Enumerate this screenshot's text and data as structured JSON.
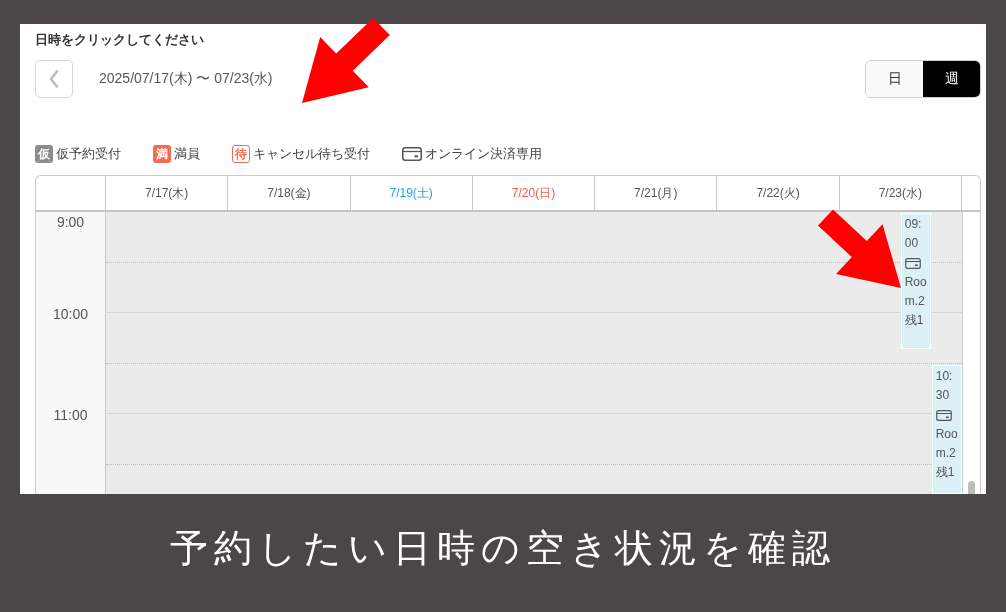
{
  "instruction": "日時をクリックしてください",
  "date_range": "2025/07/17(木) 〜 07/23(水)",
  "view_toggle": [
    {
      "label": "日",
      "selected": false
    },
    {
      "label": "週",
      "selected": true
    }
  ],
  "legend": [
    {
      "kind": "filled",
      "badge": "仮",
      "color": "#8c8c8c",
      "label": "仮予約受付"
    },
    {
      "kind": "filled",
      "badge": "満",
      "color": "#f26c4f",
      "label": "満員"
    },
    {
      "kind": "outline",
      "badge": "待",
      "color": "#f26c4f",
      "label": "キャンセル待ち受付"
    },
    {
      "kind": "card",
      "label": "オンライン決済専用"
    }
  ],
  "calendar": {
    "days": [
      {
        "label": "7/17(木)",
        "color": "#555555"
      },
      {
        "label": "7/18(金)",
        "color": "#555555"
      },
      {
        "label": "7/19(土)",
        "color": "#1ea5e0"
      },
      {
        "label": "7/20(日)",
        "color": "#f2604c"
      },
      {
        "label": "7/21(月)",
        "color": "#555555"
      },
      {
        "label": "7/22(火)",
        "color": "#555555"
      },
      {
        "label": "7/23(水)",
        "color": "#555555",
        "events": [
          {
            "time": "09:00",
            "online_payment": true,
            "room": "Room.2",
            "remaining": "残1"
          },
          {
            "time": "10:30",
            "online_payment": true,
            "room": "Room.2",
            "remaining": "残1"
          }
        ]
      }
    ],
    "time_labels": [
      "9:00",
      "10:00",
      "11:00"
    ]
  },
  "caption": "予約したい日時の空き状況を確認"
}
